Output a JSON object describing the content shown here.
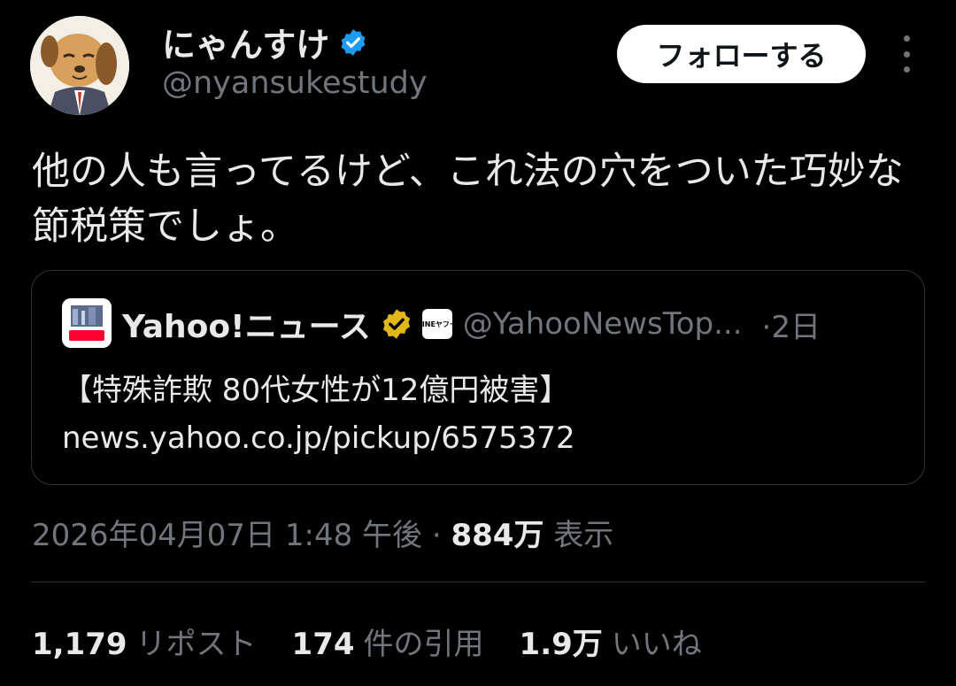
{
  "author": {
    "name": "にゃんすけ",
    "handle": "@nyansukestudy"
  },
  "follow_label": "フォローする",
  "tweet_text": "他の人も言ってるけど、これ法の穴をついた巧妙な節税策でしょ。",
  "quote": {
    "name": "Yahoo!ニュース",
    "badge_text": "LINEヤフー",
    "handle": "@YahooNewsTop...",
    "time": "·2日",
    "line1": "【特殊詐欺 80代女性が12億円被害】",
    "line2": "news.yahoo.co.jp/pickup/6575372"
  },
  "meta": {
    "datetime": "2026年04月07日 1:48 午後",
    "separator": "·",
    "views": "884万",
    "views_label": "表示"
  },
  "stats": {
    "reposts": "1,179",
    "reposts_label": "リポスト",
    "quotes": "174",
    "quotes_label": "件の引用",
    "likes": "1.9万",
    "likes_label": "いいね"
  },
  "colors": {
    "verified_blue": "#1d9bf0",
    "verified_gold": "#e2b719",
    "muted": "#71767b",
    "text": "#e7e9ea"
  },
  "icons": [
    "verified-badge-icon",
    "more-options-icon",
    "gold-verified-icon"
  ]
}
